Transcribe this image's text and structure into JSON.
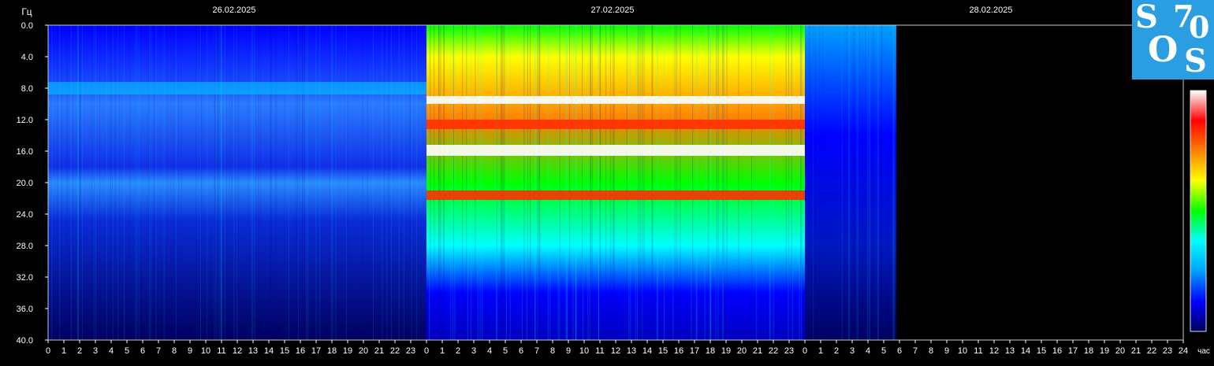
{
  "chart_data": {
    "type": "heatmap",
    "y_unit_label": "Гц",
    "x_unit_label": "час",
    "ylim": [
      0,
      40
    ],
    "y_ticks": [
      "0.0",
      "4.0",
      "8.0",
      "12.0",
      "16.0",
      "20.0",
      "24.0",
      "28.0",
      "32.0",
      "36.0",
      "40.0"
    ],
    "y_direction": "down",
    "days": [
      {
        "label": "26.02.2025",
        "hours": [
          "0",
          "1",
          "2",
          "3",
          "4",
          "5",
          "6",
          "7",
          "8",
          "9",
          "10",
          "11",
          "12",
          "13",
          "14",
          "15",
          "16",
          "17",
          "18",
          "19",
          "20",
          "21",
          "22",
          "23"
        ],
        "data_from_hour": 0,
        "data_to_hour": 24,
        "intensity": "low"
      },
      {
        "label": "27.02.2025",
        "hours": [
          "0",
          "1",
          "2",
          "3",
          "4",
          "5",
          "6",
          "7",
          "8",
          "9",
          "10",
          "11",
          "12",
          "13",
          "14",
          "15",
          "16",
          "17",
          "18",
          "19",
          "20",
          "21",
          "22",
          "23"
        ],
        "data_from_hour": 0,
        "data_to_hour": 24,
        "intensity": "high"
      },
      {
        "label": "28.02.2025",
        "hours": [
          "0",
          "1",
          "2",
          "3",
          "4",
          "5",
          "6",
          "7",
          "8",
          "9",
          "10",
          "11",
          "12",
          "13",
          "14",
          "15",
          "16",
          "17",
          "18",
          "19",
          "20",
          "21",
          "22",
          "23",
          "24"
        ],
        "data_from_hour": 0,
        "data_to_hour": 5.8,
        "intensity": "mixed"
      }
    ],
    "strong_bands_hz": [
      {
        "from": 9.0,
        "to": 10.0,
        "day": "27.02.2025",
        "level": "max"
      },
      {
        "from": 15.2,
        "to": 16.6,
        "day": "27.02.2025",
        "level": "max"
      },
      {
        "from": 12.0,
        "to": 13.2,
        "day": "27.02.2025",
        "level": "high"
      },
      {
        "from": 21.0,
        "to": 22.2,
        "day": "27.02.2025",
        "level": "high"
      },
      {
        "from": 7.2,
        "to": 8.8,
        "day": "26.02.2025",
        "level": "medium"
      }
    ],
    "colorscale": [
      "#000060",
      "#0000ff",
      "#00a0ff",
      "#00ffff",
      "#00ff00",
      "#ffff00",
      "#ff8000",
      "#ff0000",
      "#ffffff"
    ],
    "grid": false
  },
  "logo": {
    "l1": "S",
    "l2": "7",
    "l3": "0",
    "l4": "O",
    "l5": "S"
  }
}
